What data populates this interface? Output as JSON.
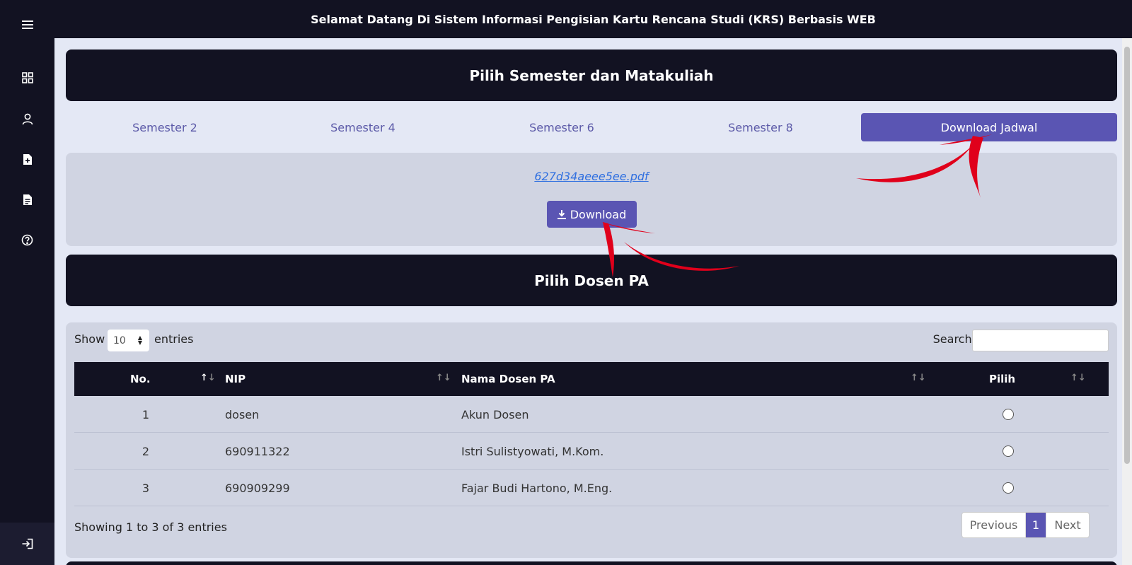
{
  "header": {
    "title": "Selamat Datang Di Sistem Informasi Pengisian Kartu Rencana Studi (KRS) Berbasis WEB"
  },
  "sidebar": {
    "items": [
      {
        "icon": "menu-icon"
      },
      {
        "icon": "dashboard-icon"
      },
      {
        "icon": "user-icon"
      },
      {
        "icon": "file-add-icon"
      },
      {
        "icon": "document-icon"
      },
      {
        "icon": "help-icon"
      }
    ],
    "logout_icon": "logout-icon"
  },
  "semester_section": {
    "title": "Pilih Semester dan Matakuliah",
    "tabs": [
      {
        "label": "Semester 2"
      },
      {
        "label": "Semester 4"
      },
      {
        "label": "Semester 6"
      },
      {
        "label": "Semester 8"
      },
      {
        "label": "Download Jadwal",
        "active": true
      }
    ]
  },
  "download_panel": {
    "file_name": "627d34aeee5ee.pdf",
    "button_label": "Download",
    "button_icon": "download-icon"
  },
  "dosen_section": {
    "title": "Pilih Dosen PA",
    "show_label": "Show",
    "entries_value": "10",
    "entries_label": "entries",
    "search_label": "Search:",
    "columns": [
      "No.",
      "NIP",
      "Nama Dosen PA",
      "Pilih"
    ],
    "rows": [
      {
        "no": "1",
        "nip": "dosen",
        "nama": "Akun Dosen"
      },
      {
        "no": "2",
        "nip": "690911322",
        "nama": "Istri Sulistyowati, M.Kom."
      },
      {
        "no": "3",
        "nip": "690909299",
        "nama": "Fajar Budi Hartono, M.Eng."
      }
    ],
    "info": "Showing 1 to 3 of 3 entries",
    "pagination": {
      "previous": "Previous",
      "current": "1",
      "next": "Next"
    }
  },
  "colors": {
    "dark": "#121222",
    "accent": "#5a55b3",
    "panel": "#d0d4e2",
    "background": "#e4e8f5",
    "annotation": "#e0001b"
  }
}
